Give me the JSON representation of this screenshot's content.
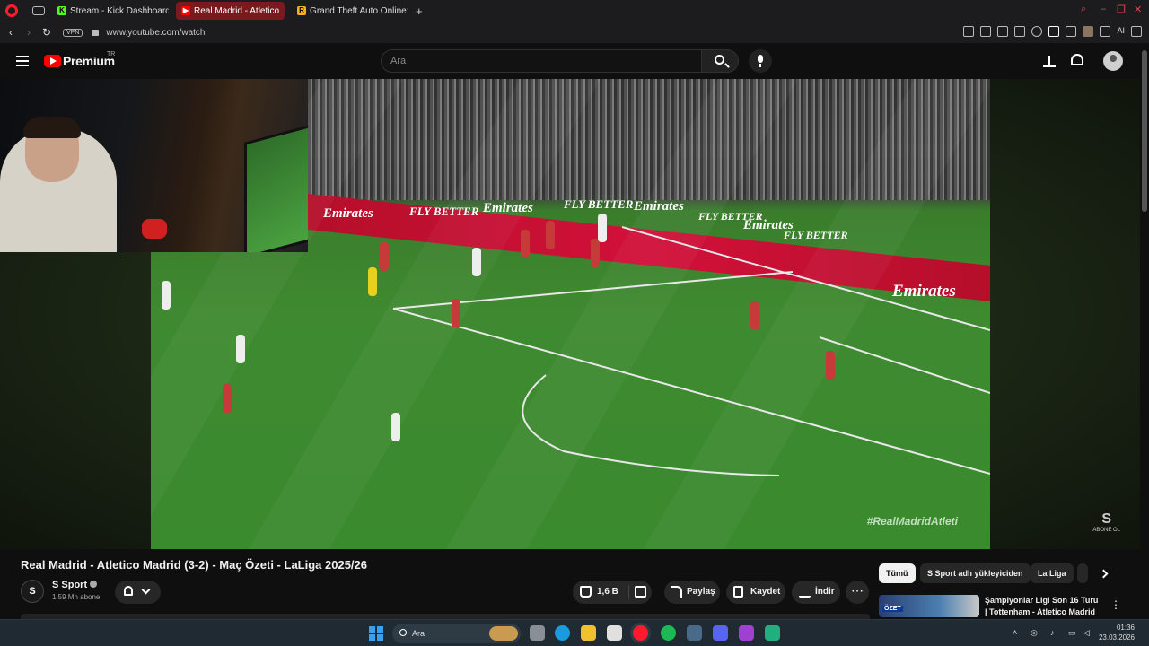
{
  "browser": {
    "tabs": [
      {
        "label": "Stream - Kick Dashboard",
        "favicon": "K",
        "favicon_color": "#53fc18"
      },
      {
        "label": "Real Madrid - Atletico",
        "favicon": "▶",
        "favicon_color": "#ff0000"
      },
      {
        "label": "Grand Theft Auto Online: F",
        "favicon": "R",
        "favicon_color": "#f2b31b"
      }
    ],
    "active_tab_index": 1,
    "url": "www.youtube.com/watch",
    "vpn_label": "VPN",
    "ai_label": "AI"
  },
  "youtube": {
    "logo_text": "Premium",
    "region": "TR",
    "search_placeholder": "Ara"
  },
  "video": {
    "hashtag": "#RealMadridAtleti",
    "board_brands": [
      "Emirates",
      "FLY BETTER",
      "Emirates",
      "FLY BETTER",
      "Emirates",
      "FLY BETTER",
      "Emirates",
      "FLY BETTER",
      "Emirates"
    ],
    "watermark": "ABONE OL",
    "title": "Real Madrid - Atletico Madrid (3-2) - Maç Özeti - LaLiga 2025/26",
    "channel": {
      "name": "S Sport",
      "logo": "S",
      "subscribers": "1,59 Mn abone"
    },
    "actions": {
      "likes": "1,6 B",
      "share": "Paylaş",
      "save": "Kaydet",
      "download": "İndir"
    }
  },
  "sidebar": {
    "chips": [
      "Tümü",
      "S Sport adlı yükleyiciden",
      "La Liga"
    ],
    "recommended": {
      "title": "Şampiyonlar Ligi Son 16 Turu | Tottenham - Atletico Madrid ...",
      "badge": "ÖZET"
    }
  },
  "taskbar": {
    "search_label": "Ara",
    "time": "01:36",
    "date": "23.03.2026"
  },
  "colors": {
    "accent": "#ff0000",
    "opera": "#ff1b2d",
    "active_tab": "#7a1a1f"
  }
}
